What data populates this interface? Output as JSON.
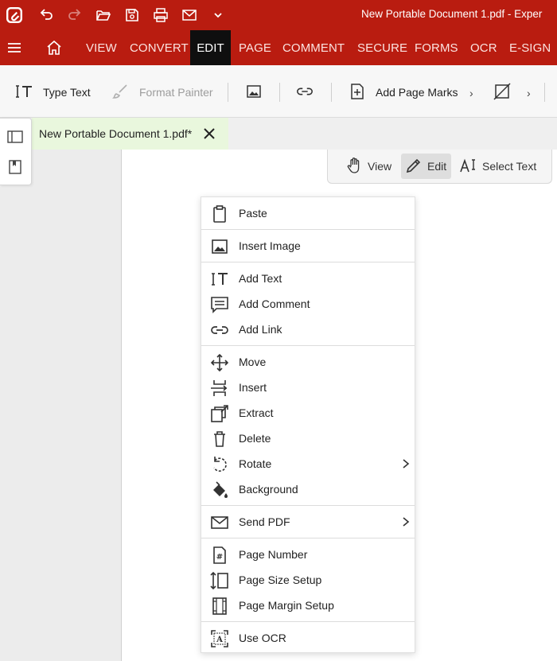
{
  "window": {
    "title": "New Portable Document 1.pdf  -  Exper"
  },
  "quick_access": [
    "app-logo",
    "undo",
    "redo",
    "open-folder",
    "save",
    "print",
    "email",
    "more"
  ],
  "menu": {
    "tabs": [
      "VIEW",
      "CONVERT",
      "EDIT",
      "PAGE",
      "COMMENT",
      "SECURE",
      "FORMS",
      "OCR",
      "E-SIGN"
    ],
    "active": "EDIT"
  },
  "ribbon": {
    "type_text": "Type Text",
    "format_painter": "Format Painter",
    "add_page_marks": "Add Page Marks"
  },
  "document_tab": {
    "name": "New Portable Document 1.pdf*"
  },
  "mode_toolbar": {
    "view": "View",
    "edit": "Edit",
    "select_text": "Select Text",
    "active": "Edit"
  },
  "context_menu": {
    "items": [
      {
        "label": "Paste",
        "icon": "clipboard-icon"
      },
      {
        "label": "Insert Image",
        "icon": "image-icon"
      },
      {
        "label": "Add Text",
        "icon": "text-cursor-icon"
      },
      {
        "label": "Add Comment",
        "icon": "comment-icon"
      },
      {
        "label": "Add Link",
        "icon": "link-icon"
      },
      {
        "label": "Move",
        "icon": "move-icon"
      },
      {
        "label": "Insert",
        "icon": "insert-page-icon"
      },
      {
        "label": "Extract",
        "icon": "extract-icon"
      },
      {
        "label": "Delete",
        "icon": "trash-icon"
      },
      {
        "label": "Rotate",
        "icon": "rotate-icon",
        "submenu": true
      },
      {
        "label": "Background",
        "icon": "paint-bucket-icon"
      },
      {
        "label": "Send PDF",
        "icon": "envelope-icon",
        "submenu": true
      },
      {
        "label": "Page Number",
        "icon": "page-number-icon"
      },
      {
        "label": "Page Size Setup",
        "icon": "page-size-icon"
      },
      {
        "label": "Page Margin Setup",
        "icon": "page-margin-icon"
      },
      {
        "label": "Use OCR",
        "icon": "ocr-icon"
      }
    ]
  },
  "colors": {
    "brand_red": "#b91c10",
    "active_tab": "#0f0f0f",
    "doc_tab_bg": "#e9f7dd"
  }
}
